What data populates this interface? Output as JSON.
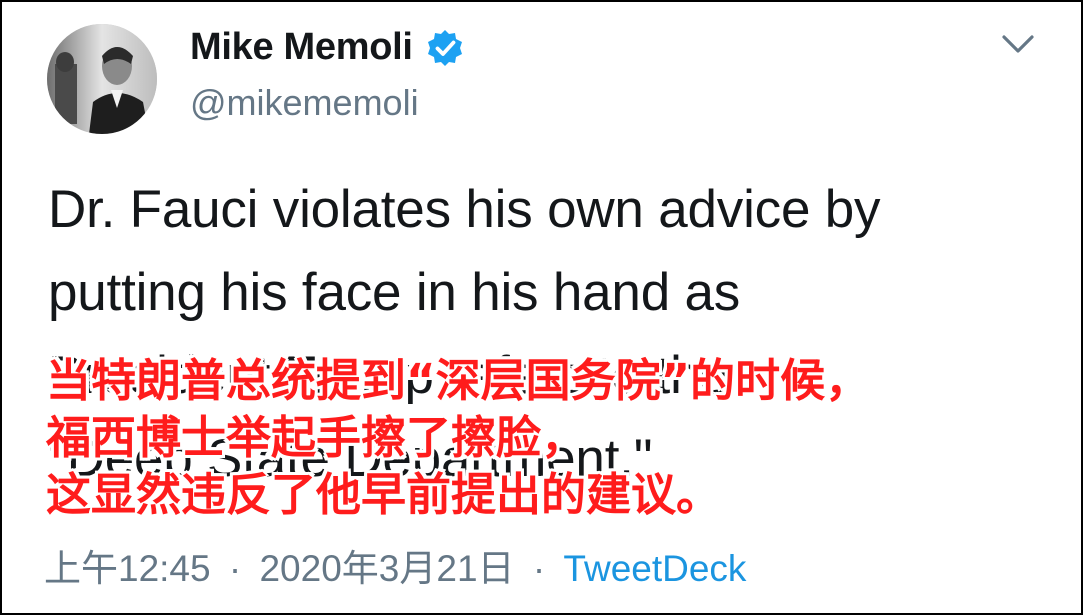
{
  "author": {
    "display_name": "Mike Memoli",
    "handle": "@mikememoli",
    "verified": true
  },
  "icons": {
    "avatar": "profile-photo",
    "verified": "verified-badge-icon",
    "menu": "chevron-down-icon"
  },
  "tweet": {
    "lines": [
      "Dr. Fauci violates his own advice by",
      "putting his face in his hand as",
      "President Trump refers to the",
      "\"Deep State Department.\""
    ]
  },
  "subtitle": {
    "lines": [
      "当特朗普总统提到“深层国务院”的时候，",
      "福西博士举起手擦了擦脸，",
      "这显然违反了他早前提出的建议。"
    ]
  },
  "meta": {
    "time": "上午12:45",
    "separator": "·",
    "date": "2020年3月21日",
    "source": "TweetDeck"
  },
  "colors": {
    "text": "#14171a",
    "secondary": "#657786",
    "link": "#1b95e0",
    "verified": "#1da1f2",
    "subtitle": "#ff1c1c"
  }
}
